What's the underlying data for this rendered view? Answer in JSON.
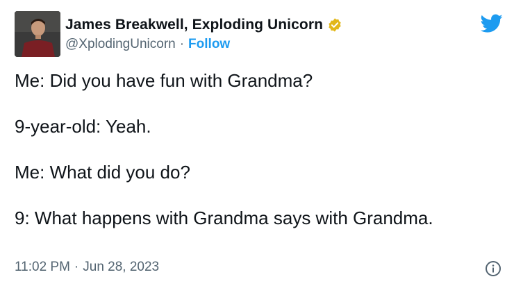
{
  "tweet": {
    "author": {
      "display_name": "James Breakwell, Exploding Unicorn",
      "handle": "@XplodingUnicorn",
      "separator": "·",
      "follow_label": "Follow",
      "avatar_icon": "profile-photo",
      "verified_icon": "verified-badge-icon"
    },
    "body": {
      "line1": "Me: Did you have fun with Grandma?",
      "line2": "9-year-old: Yeah.",
      "line3": "Me: What did you do?",
      "line4": "9: What happens with Grandma says with Grandma."
    },
    "meta": {
      "time": "11:02 PM",
      "separator": "·",
      "date": "Jun 28, 2023"
    },
    "icons": {
      "brand": "twitter-bird-icon",
      "info": "info-icon"
    },
    "colors": {
      "text": "#0f1419",
      "secondary": "#536471",
      "link": "#1d9bf0",
      "verified_gold": "#e2b719"
    }
  }
}
